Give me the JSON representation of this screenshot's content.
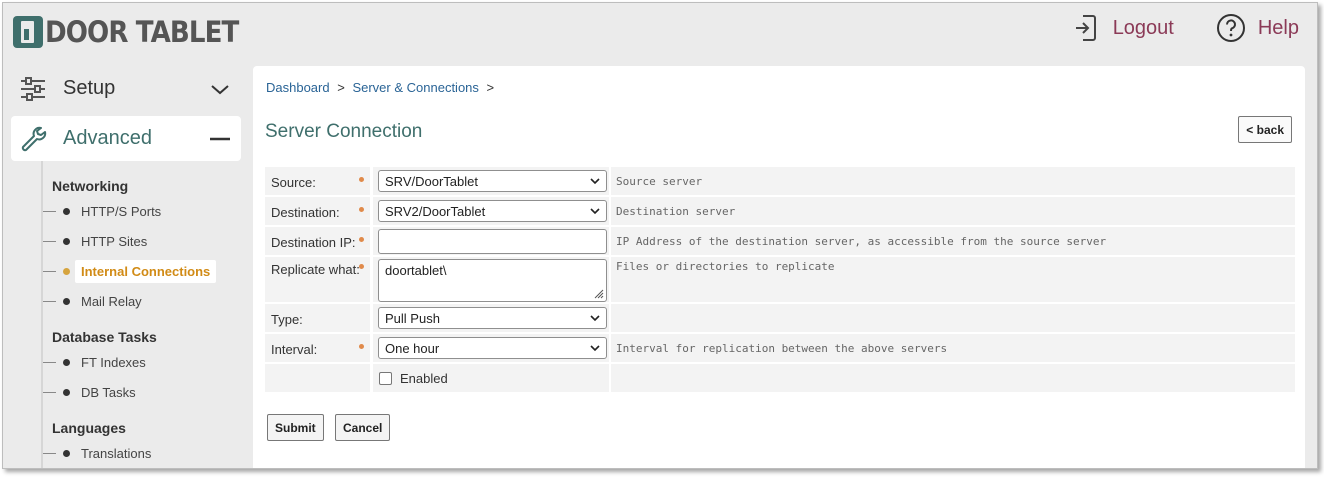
{
  "brand": {
    "name": "DOOR TABLET",
    "accent": "#3f6f6c",
    "link_color": "#8b3a57"
  },
  "header": {
    "logout_label": "Logout",
    "help_label": "Help"
  },
  "sidebar": {
    "menus": [
      {
        "label": "Setup",
        "icon": "sliders-icon",
        "state": "collapsed"
      },
      {
        "label": "Advanced",
        "icon": "wrench-icon",
        "state": "expanded"
      }
    ],
    "groups": [
      {
        "title": "Networking",
        "items": [
          "HTTP/S Ports",
          "HTTP Sites",
          "Internal Connections",
          "Mail Relay"
        ]
      },
      {
        "title": "Database Tasks",
        "items": [
          "FT Indexes",
          "DB Tasks"
        ]
      },
      {
        "title": "Languages",
        "items": [
          "Translations"
        ]
      }
    ],
    "active_item": "Internal Connections"
  },
  "breadcrumb": {
    "items": [
      "Dashboard",
      "Server & Connections"
    ],
    "separator": ">"
  },
  "page": {
    "title": "Server Connection",
    "back_label": "< back"
  },
  "form": {
    "source": {
      "label": "Source:",
      "value": "SRV/DoorTablet",
      "hint": "Source server"
    },
    "destination": {
      "label": "Destination:",
      "value": "SRV2/DoorTablet",
      "hint": "Destination server"
    },
    "destination_ip": {
      "label": "Destination IP:",
      "value": "",
      "hint": "IP Address of the destination server, as accessible from the source server"
    },
    "replicate": {
      "label": "Replicate what:",
      "value": "doortablet\\",
      "hint": "Files or directories to replicate"
    },
    "type": {
      "label": "Type:",
      "value": "Pull Push",
      "hint": ""
    },
    "interval": {
      "label": "Interval:",
      "value": "One hour",
      "hint": "Interval for replication between the above servers"
    },
    "enabled": {
      "label": "Enabled",
      "checked": false
    }
  },
  "actions": {
    "submit_label": "Submit",
    "cancel_label": "Cancel"
  }
}
